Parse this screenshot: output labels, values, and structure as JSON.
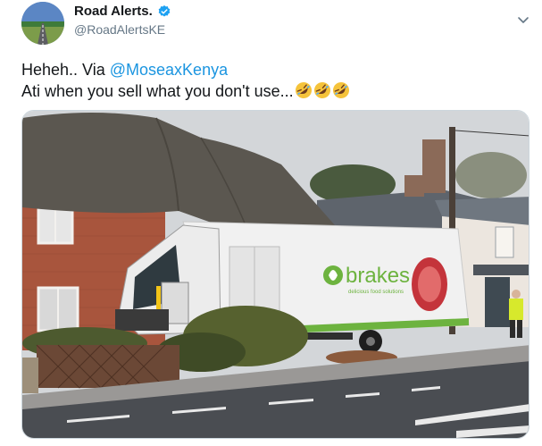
{
  "author": {
    "display_name": "Road Alerts.",
    "handle": "@RoadAlertsKE",
    "avatar_icon": "road-avatar-icon",
    "verified_icon": "verified-badge-icon",
    "verified_color": "#1da1f2"
  },
  "menu": {
    "icon": "chevron-down-icon"
  },
  "tweet": {
    "line1_prefix": "Heheh.. Via ",
    "mention": "@MoseaxKenya",
    "line2": "Ati when you sell what you don't use...",
    "emoji_count": 3,
    "emoji_icon": "rolling-on-floor-laughing-icon"
  },
  "media": {
    "truck_brand": "brakes",
    "truck_tagline": "delicious food solutions"
  },
  "colors": {
    "mention": "#1b95e0",
    "brand_green": "#6db33f"
  }
}
